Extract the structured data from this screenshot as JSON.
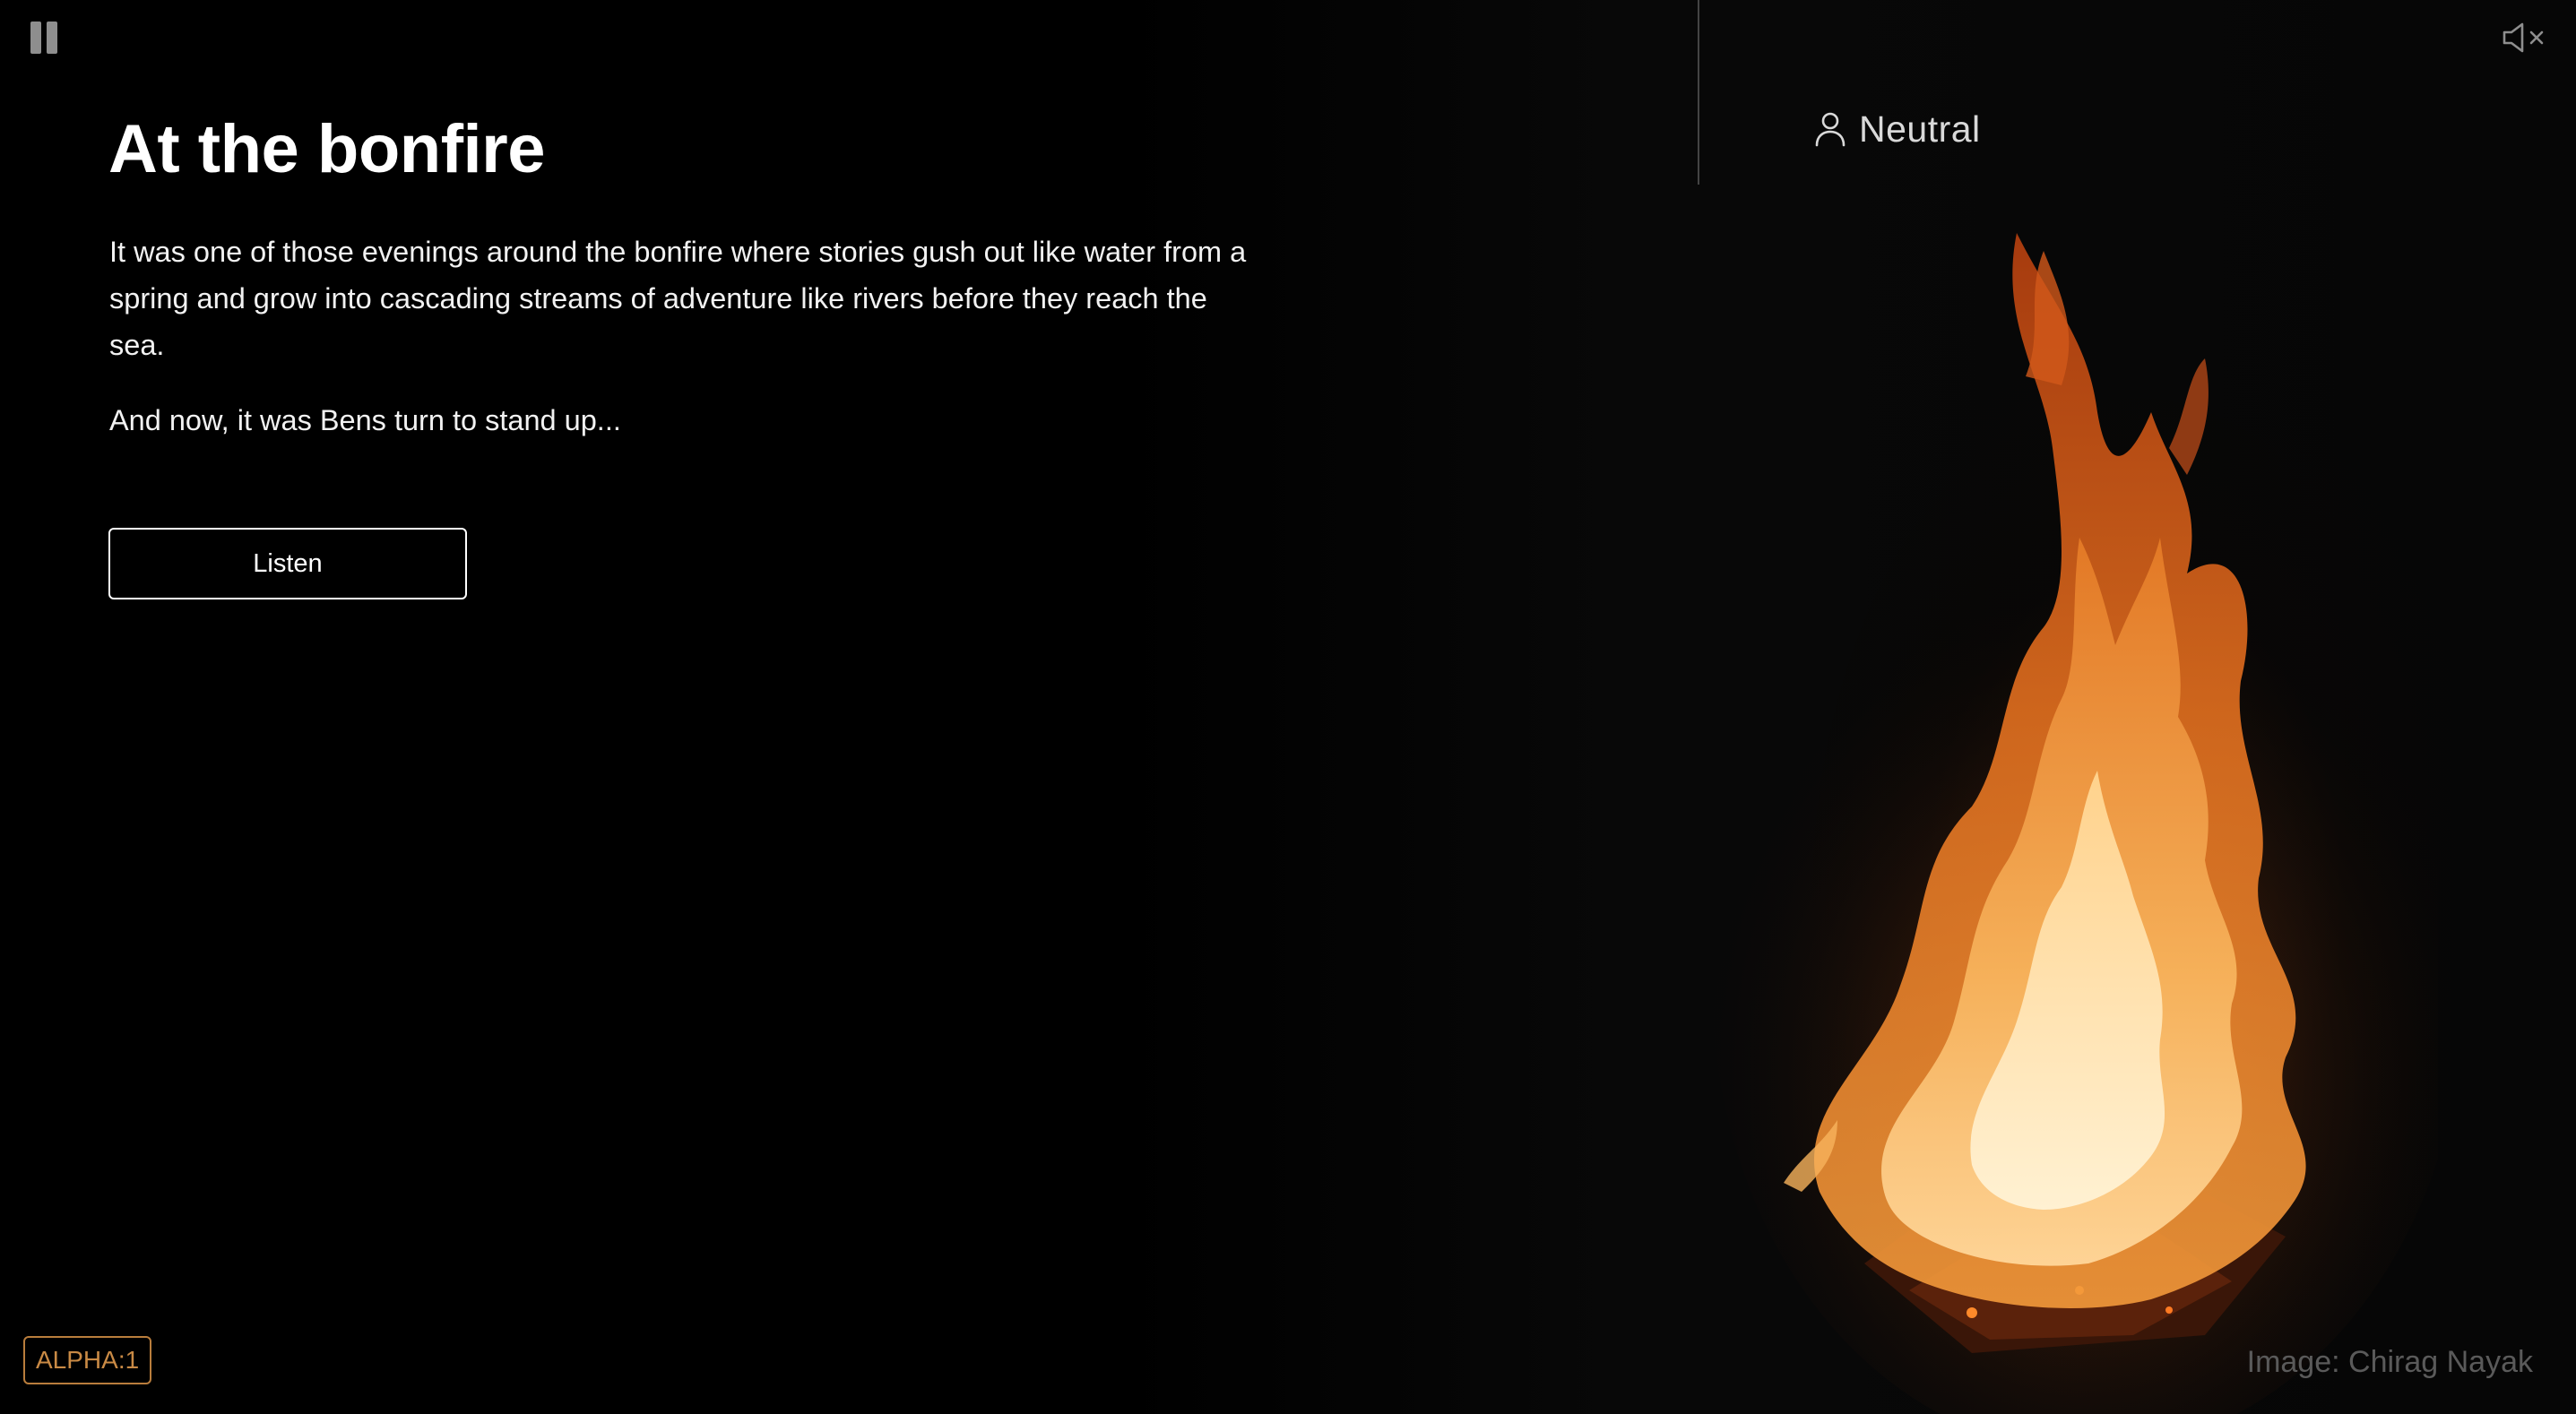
{
  "controls": {
    "pause_icon": "pause-icon",
    "mute_icon": "speaker-muted-icon"
  },
  "character": {
    "icon": "person-icon",
    "label": "Neutral"
  },
  "story": {
    "title": "At the bonfire",
    "paragraphs": [
      "It was one of those evenings around the bonfire where stories gush out like water from a spring and grow into cascading streams of adventure like rivers before they reach the sea.",
      "And now, it was Bens turn to stand up..."
    ],
    "listen_label": "Listen"
  },
  "footer": {
    "version": "ALPHA:1",
    "credit": "Image: Chirag Nayak"
  },
  "colors": {
    "background": "#000000",
    "text": "#ffffff",
    "badge_accent": "#c98a45",
    "credit_text": "#5a5a5a",
    "icon_grey": "#8e8e8e"
  }
}
